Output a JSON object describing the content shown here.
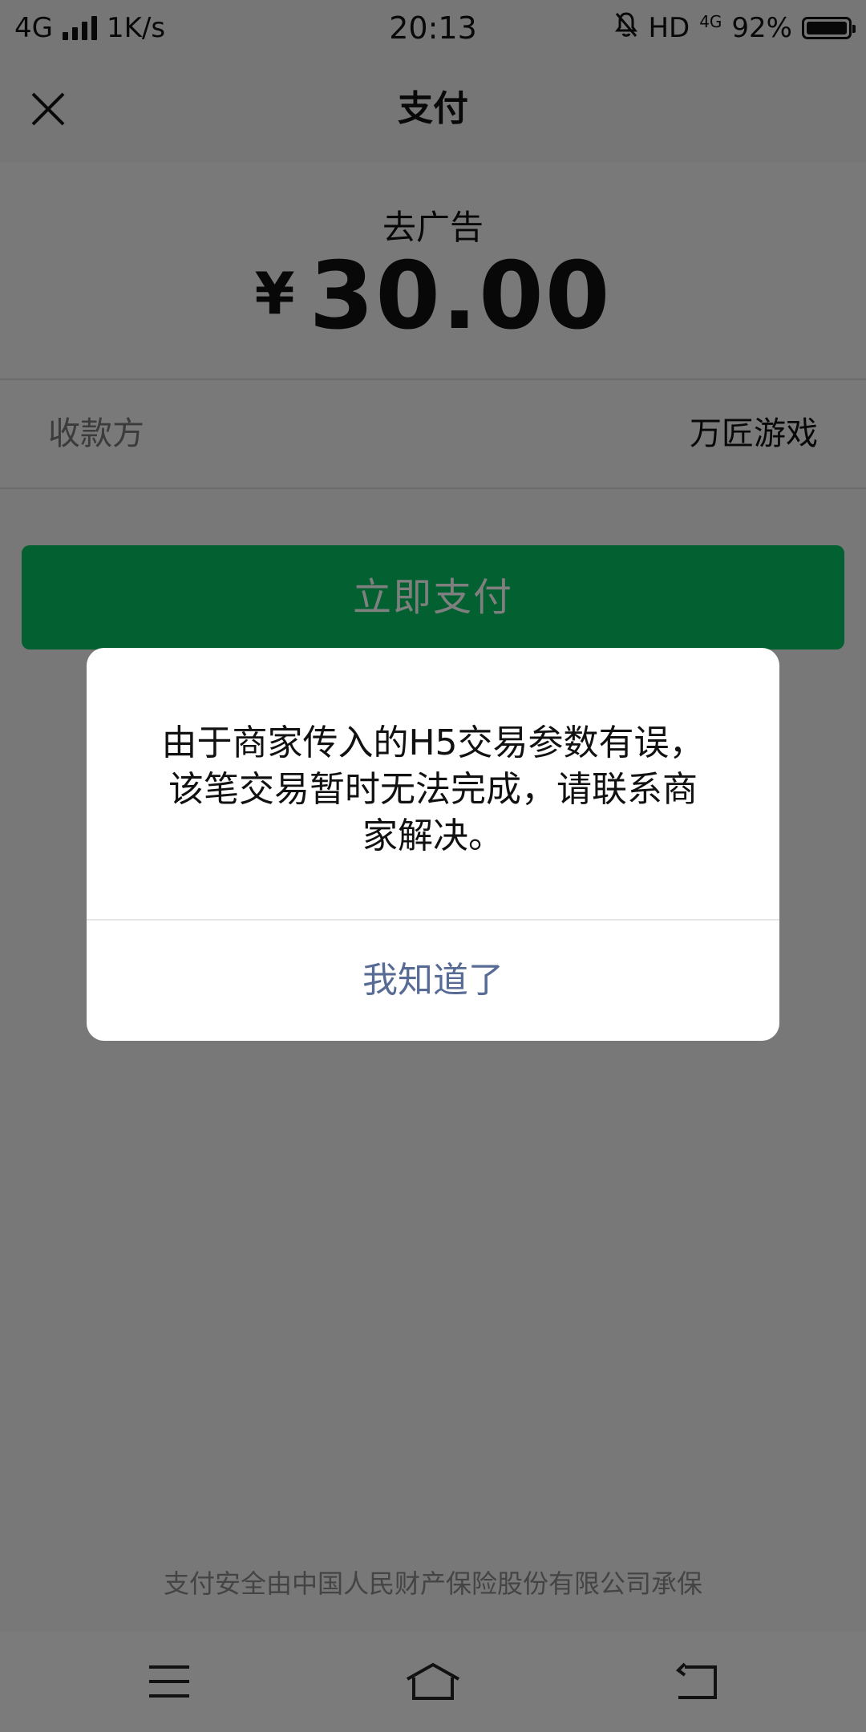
{
  "status_bar": {
    "network": "4G",
    "speed": "1K/s",
    "time": "20:13",
    "hd": "HD",
    "network_small": "4G",
    "battery": "92%"
  },
  "nav": {
    "title": "支付"
  },
  "order": {
    "name": "去广告",
    "currency": "¥",
    "amount": "30.00"
  },
  "payee": {
    "label": "收款方",
    "value": "万匠游戏"
  },
  "pay_button": {
    "label": "立即支付"
  },
  "dialog": {
    "message_line1": "由于商家传入的H5交易参数有误，",
    "message_line2": "该笔交易暂时无法完成，请联系商",
    "message_line3": "家解决。",
    "confirm_label": "我知道了"
  },
  "footer": {
    "text": "支付安全由中国人民财产保险股份有限公司承保"
  },
  "colors": {
    "pay_green": "#07c160",
    "dialog_link": "#576b95"
  }
}
